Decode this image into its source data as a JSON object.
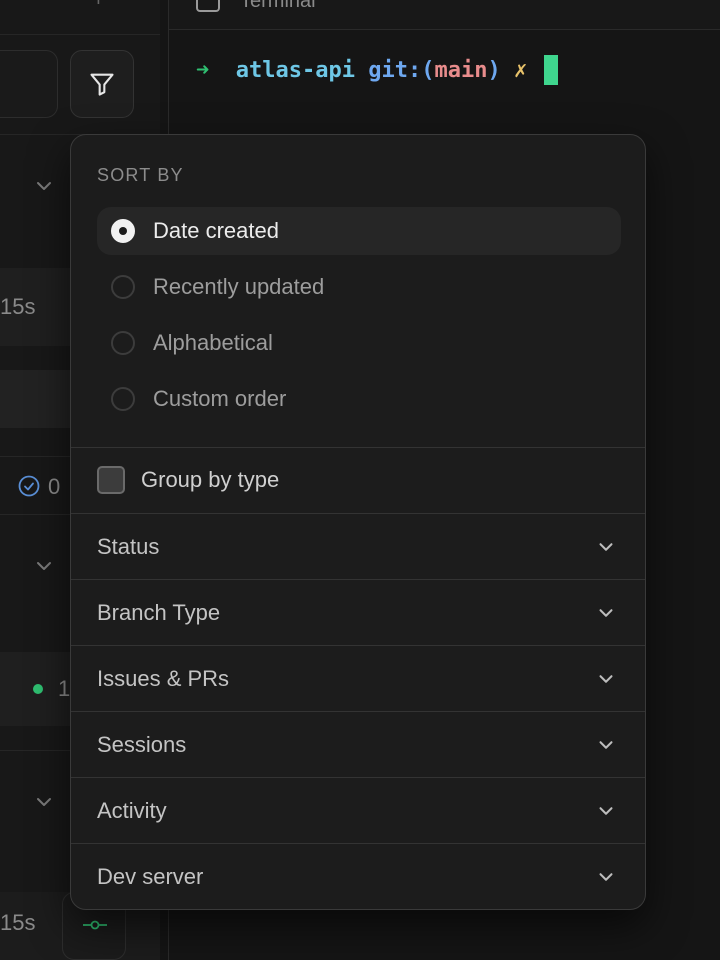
{
  "left_panel": {
    "row_durations": [
      "15s",
      "15s"
    ],
    "check_count": "0",
    "green_count": "1"
  },
  "terminal": {
    "title": "Terminal",
    "prompt_arrow": "➜",
    "directory": "atlas-api",
    "git_label": "git:(",
    "branch": "main",
    "git_close": ")",
    "dirty_mark": "✗"
  },
  "sort_menu": {
    "section_title": "SORT BY",
    "options": [
      {
        "label": "Date created",
        "selected": true
      },
      {
        "label": "Recently updated",
        "selected": false
      },
      {
        "label": "Alphabetical",
        "selected": false
      },
      {
        "label": "Custom order",
        "selected": false
      }
    ],
    "group_by_type": {
      "label": "Group by type",
      "checked": false
    },
    "filter_sections": [
      "Status",
      "Branch Type",
      "Issues & PRs",
      "Sessions",
      "Activity",
      "Dev server"
    ]
  },
  "icons": {
    "filter": "filter-icon",
    "chevron": "chevron-down-icon",
    "check": "check-circle-icon",
    "terminal": "terminal-icon"
  },
  "colors": {
    "accent_green": "#3fd68e",
    "popover_bg": "#1c1c1c",
    "page_bg": "#151515"
  }
}
